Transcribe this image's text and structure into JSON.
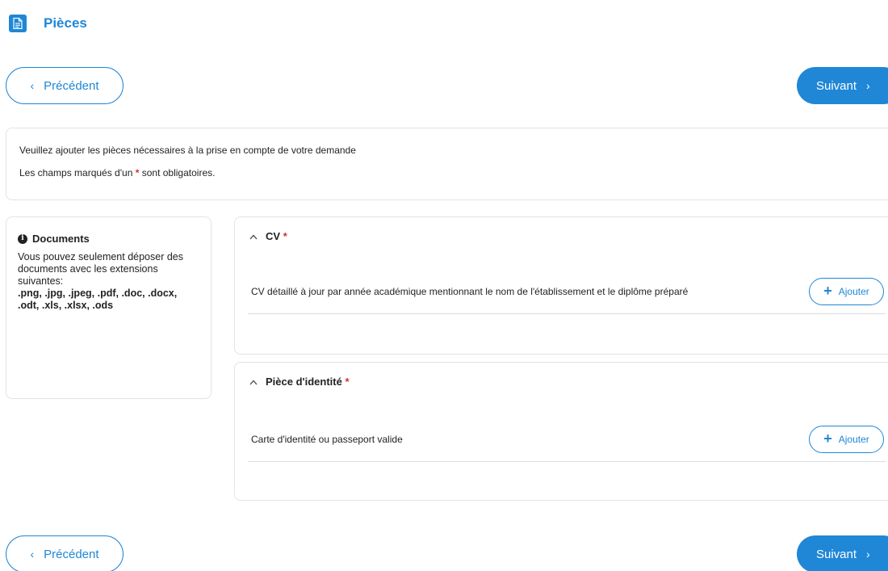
{
  "header": {
    "title": "Pièces",
    "icon": "document-icon",
    "accent": "#1f87d6"
  },
  "nav": {
    "prev_label": "Précédent",
    "next_label": "Suivant",
    "prev_chevron": "‹",
    "next_chevron": "›"
  },
  "info": {
    "line1": "Veuillez ajouter les pièces nécessaires à la prise en compte de votre demande",
    "line2_before": "Les champs marqués d'un",
    "required_mark": "*",
    "line2_after": "sont obligatoires."
  },
  "documents": {
    "title": "Documents",
    "description": "Vous pouvez seulement déposer des documents avec les extensions suivantes:",
    "extensions": ".png, .jpg, .jpeg, .pdf, .doc, .docx, .odt, .xls, .xlsx, .ods"
  },
  "sections": [
    {
      "title": "CV",
      "required": "*",
      "item_text": "CV détaillé à jour par année académique mentionnant le nom de l'établissement et le diplôme préparé",
      "add_label": "Ajouter"
    },
    {
      "title": "Pièce d'identité",
      "required": "*",
      "item_text": "Carte d'identité ou passeport valide",
      "add_label": "Ajouter"
    }
  ]
}
